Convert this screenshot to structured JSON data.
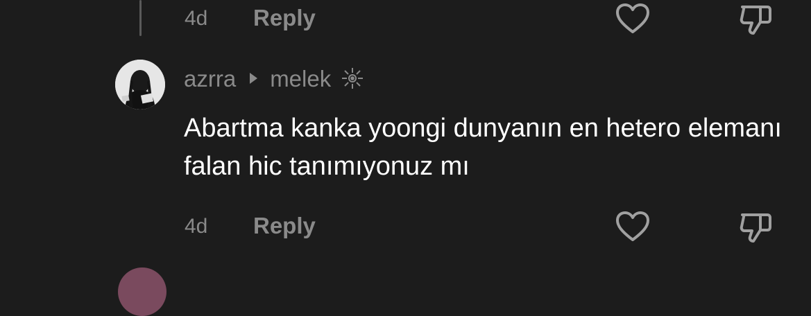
{
  "prev_comment": {
    "time": "4d",
    "reply_label": "Reply"
  },
  "comment": {
    "author": "azrra",
    "reply_to": "melek",
    "badge_icon": "sparkle-badge-icon",
    "text": "Abartma kanka yoongi dunyanın en hetero elemanı falan hic tanımıyonuz mı",
    "time": "4d",
    "reply_label": "Reply"
  },
  "icons": {
    "like": "heart-icon",
    "dislike": "thumbs-down-icon"
  },
  "colors": {
    "background": "#1c1c1c",
    "muted_text": "#8a8a8a",
    "primary_text": "#ffffff"
  }
}
